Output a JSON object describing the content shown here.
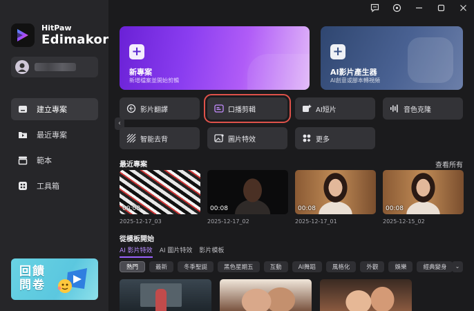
{
  "app": {
    "brand_top": "HitPaw",
    "brand_bottom": "Edimakor"
  },
  "sidebar": {
    "items": [
      {
        "label": "建立專案",
        "icon": "create-project-icon",
        "active": true
      },
      {
        "label": "最近專案",
        "icon": "recent-folder-icon",
        "active": false
      },
      {
        "label": "範本",
        "icon": "template-icon",
        "active": false
      },
      {
        "label": "工具箱",
        "icon": "toolbox-icon",
        "active": false
      }
    ],
    "promo": {
      "line1": "回饋",
      "line2": "問卷"
    }
  },
  "hero": {
    "new_project": {
      "title": "新專案",
      "subtitle": "新增檔案並開始剪輯"
    },
    "ai_video": {
      "title": "AI影片產生器",
      "subtitle": "AI創意或腳本轉視頻"
    }
  },
  "tools": [
    {
      "label": "影片翻譯",
      "icon": "translate-icon"
    },
    {
      "label": "口播剪輯",
      "icon": "talking-edit-icon",
      "highlighted": true
    },
    {
      "label": "AI短片",
      "icon": "ai-short-icon"
    },
    {
      "label": "音色克隆",
      "icon": "voice-clone-icon"
    },
    {
      "label": "智能去背",
      "icon": "remove-bg-icon"
    },
    {
      "label": "圖片特效",
      "icon": "image-effect-icon"
    },
    {
      "label": "更多",
      "icon": "more-grid-icon"
    }
  ],
  "recent": {
    "title": "最近專案",
    "view_all": "查看所有",
    "projects": [
      {
        "duration": "00:08",
        "date": "2025-12-17_03"
      },
      {
        "duration": "00:08",
        "date": "2025-12-17_02"
      },
      {
        "duration": "00:08",
        "date": "2025-12-17_01"
      },
      {
        "duration": "00:08",
        "date": "2025-12-15_02"
      }
    ]
  },
  "templates": {
    "title": "從模板開始",
    "tabs": [
      {
        "label": "AI 影片特效",
        "active": true
      },
      {
        "label": "AI 圖片特效",
        "active": false
      },
      {
        "label": "影片模板",
        "active": false
      }
    ],
    "chips": [
      "熱門",
      "最新",
      "冬季聖誕",
      "黑色星期五",
      "互動",
      "AI舞蹈",
      "風格化",
      "外觀",
      "娛樂",
      "經典變身"
    ]
  },
  "colors": {
    "accent": "#9b63ff",
    "highlight": "#e0524a",
    "bg": "#1b1b1d",
    "panel": "#262629"
  }
}
